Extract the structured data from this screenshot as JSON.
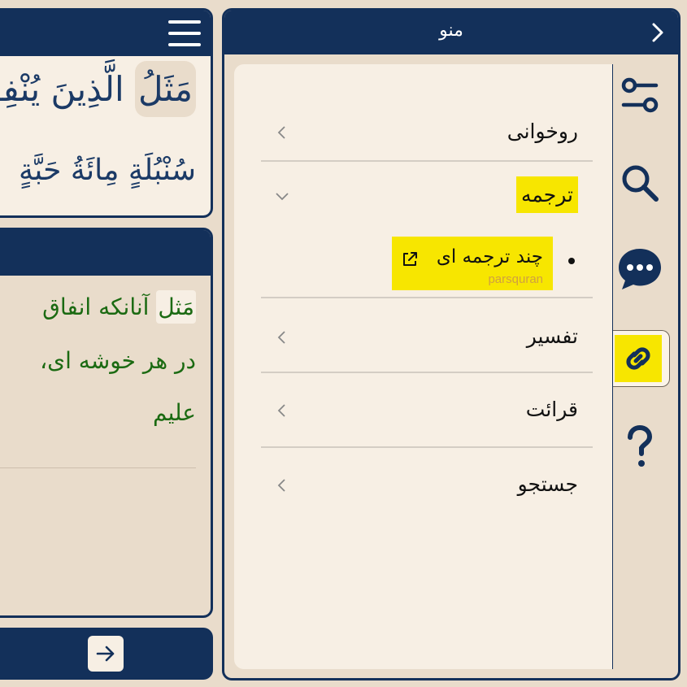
{
  "reader": {
    "arabic_line1_highlighted": "مَثَلُ",
    "arabic_line1_rest": "الَّذِينَ يُنْفِقُونَ",
    "arabic_line2": "سُنْبُلَةٍ مِائَةُ حَبَّةٍ",
    "translation_line1_highlighted": "مَثل",
    "translation_line1_rest": "آنانکه انفاق",
    "translation_line2": "در هر خوشه ای،",
    "translation_line3": "علیم"
  },
  "menu": {
    "title": "منو",
    "items": [
      {
        "label": "روخوانی",
        "expanded": false
      },
      {
        "label": "ترجمه",
        "expanded": true,
        "highlighted": true
      },
      {
        "label": "تفسیر",
        "expanded": false
      },
      {
        "label": "قرائت",
        "expanded": false
      },
      {
        "label": "جستجو",
        "expanded": false
      }
    ],
    "subitem": {
      "label": "چند ترجمه ای",
      "source": "parsquran",
      "icon": "external-link-icon"
    }
  },
  "rail": {
    "icons": [
      "settings-sliders-icon",
      "search-icon",
      "chat-icon",
      "link-icon",
      "help-icon"
    ],
    "active": "link-icon"
  },
  "colors": {
    "navy": "#13305a",
    "panel": "#f7efe4",
    "background": "#e9dccb",
    "highlight": "#f7e600",
    "translation_green": "#1b6a12",
    "source_orange": "#d0a040"
  }
}
